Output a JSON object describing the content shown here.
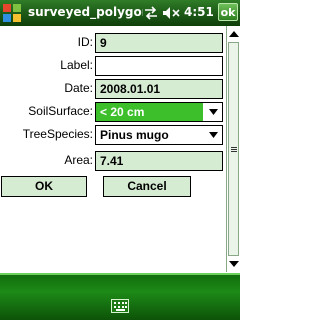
{
  "titlebar": {
    "title": "surveyed_polygon",
    "time": "4:51",
    "ok_label": "ok",
    "icons": [
      "windows-start-icon",
      "connectivity-icon",
      "volume-muted-icon"
    ]
  },
  "form": {
    "id_label": "ID:",
    "id_value": "9",
    "label_label": "Label:",
    "label_value": "",
    "date_label": "Date:",
    "date_value": "2008.01.01",
    "soil_label": "SoilSurface:",
    "soil_value": "< 20 cm",
    "tree_label": "TreeSpecies:",
    "tree_value": "Pinus mugo",
    "area_label": "Area:",
    "area_value": "7.41"
  },
  "buttons": {
    "ok_label": "OK",
    "cancel_label": "Cancel"
  },
  "colors": {
    "field_background": "#d6ecd2",
    "selected_background": "#3cbf2b",
    "titlebar": "#1f5d19",
    "menubar": "#1d8a17"
  },
  "menubar": {
    "icon": "keyboard-icon"
  }
}
